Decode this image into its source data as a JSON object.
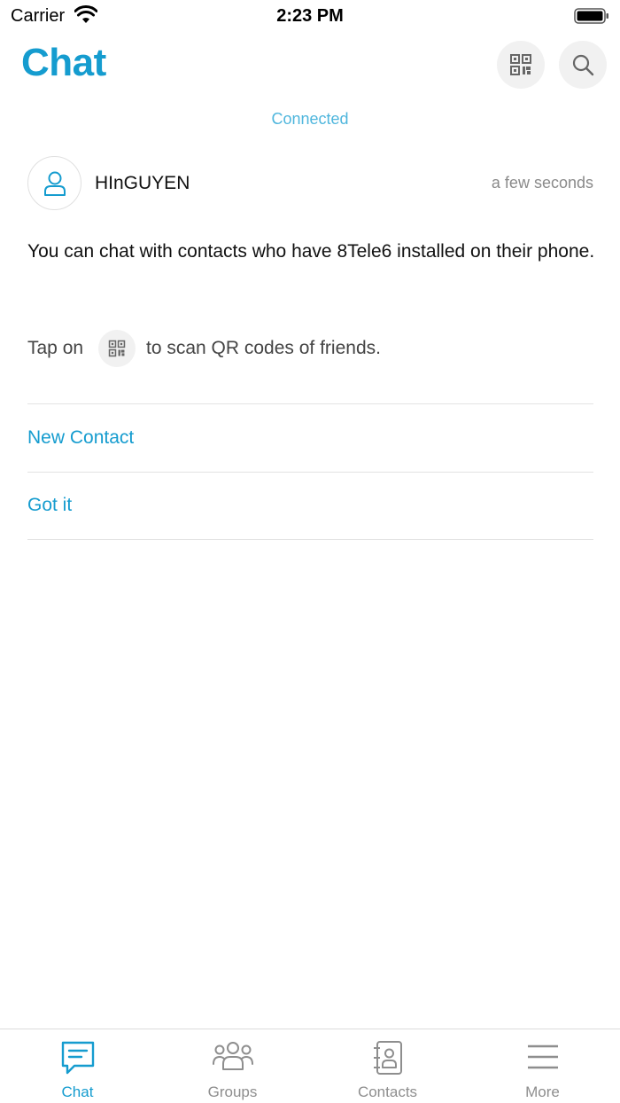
{
  "status_bar": {
    "carrier": "Carrier",
    "time": "2:23 PM"
  },
  "header": {
    "title": "Chat",
    "qr_icon": "qr-code-icon",
    "search_icon": "search-icon"
  },
  "connection_status": "Connected",
  "chat": {
    "contact_name": "HInGUYEN",
    "time": "a few seconds",
    "avatar_icon": "user-icon"
  },
  "info": {
    "message": "You can chat with contacts who have 8Tele6 installed on their phone.",
    "tap_prefix": "Tap on",
    "tap_suffix": "to scan QR codes of friends."
  },
  "actions": {
    "new_contact": "New Contact",
    "got_it": "Got it"
  },
  "tabs": [
    {
      "label": "Chat",
      "icon": "chat-icon",
      "active": true
    },
    {
      "label": "Groups",
      "icon": "groups-icon",
      "active": false
    },
    {
      "label": "Contacts",
      "icon": "contacts-icon",
      "active": false
    },
    {
      "label": "More",
      "icon": "menu-icon",
      "active": false
    }
  ],
  "colors": {
    "accent": "#159ccf",
    "connected": "#4fb6dd",
    "inactive": "#8e8e8e"
  }
}
